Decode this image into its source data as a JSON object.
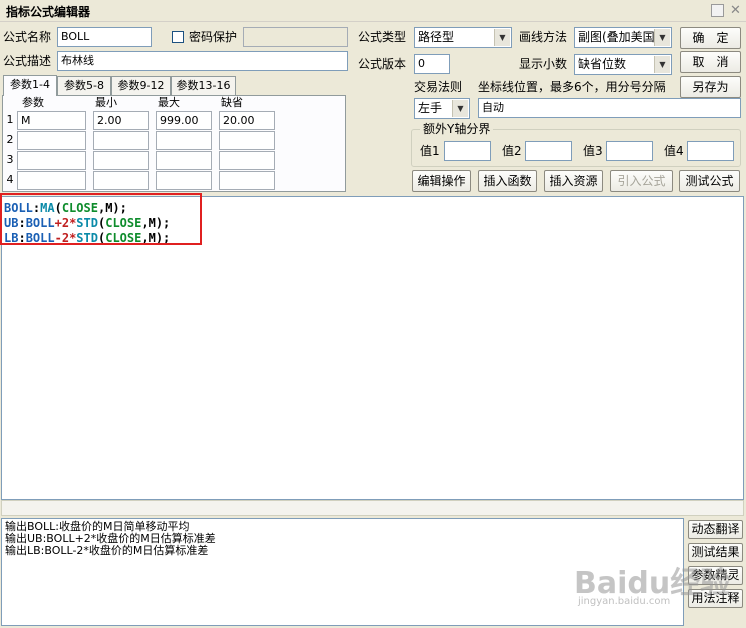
{
  "window": {
    "title": "指标公式编辑器"
  },
  "form": {
    "name_label": "公式名称",
    "name_value": "BOLL",
    "password_label": "密码保护",
    "desc_label": "公式描述",
    "desc_value": "布林线",
    "type_label": "公式类型",
    "type_value": "路径型",
    "draw_label": "画线方法",
    "draw_value": "副图(叠加美国",
    "version_label": "公式版本",
    "version_value": "0",
    "decimals_label": "显示小数",
    "decimals_value": "缺省位数",
    "trade_rule_label": "交易法则",
    "trade_rule_value": "左手",
    "coord_label": "坐标线位置，最多6个，用分号分隔",
    "coord_value": "自动",
    "yaxis_group_label": "额外Y轴分界",
    "yaxis_values": [
      "值1",
      "值2",
      "值3",
      "值4"
    ]
  },
  "buttons": {
    "ok": "确　定",
    "cancel": "取　消",
    "save_as": "另存为",
    "edit_ops": "编辑操作",
    "insert_func": "插入函数",
    "insert_res": "插入资源",
    "import_formula": "引入公式",
    "test_formula": "测试公式",
    "dynamic_translate": "动态翻译",
    "test_result": "测试结果",
    "param_tune": "参数精灵",
    "usage_notes": "用法注释"
  },
  "tabs": [
    "参数1-4",
    "参数5-8",
    "参数9-12",
    "参数13-16"
  ],
  "params": {
    "headers": [
      "参数",
      "最小",
      "最大",
      "缺省"
    ],
    "rows": [
      {
        "num": "1",
        "name": "M",
        "min": "2.00",
        "max": "999.00",
        "default": "20.00"
      },
      {
        "num": "2",
        "name": "",
        "min": "",
        "max": "",
        "default": ""
      },
      {
        "num": "3",
        "name": "",
        "min": "",
        "max": "",
        "default": ""
      },
      {
        "num": "4",
        "name": "",
        "min": "",
        "max": "",
        "default": ""
      }
    ]
  },
  "code": {
    "line1": {
      "name": "BOLL",
      "sep": ":",
      "fn": "MA",
      "open": "(",
      "arg1": "CLOSE",
      "comma": ",",
      "arg2": "M",
      "close": ");"
    },
    "line2": {
      "name": "UB",
      "sep": ":",
      "ref": "BOLL",
      "op": "+",
      "num": "2",
      "mul": "*",
      "fn": "STD",
      "open": "(",
      "arg1": "CLOSE",
      "comma": ",",
      "arg2": "M",
      "close": ");"
    },
    "line3": {
      "name": "LB",
      "sep": ":",
      "ref": "BOLL",
      "op": "-",
      "num": "2",
      "mul": "*",
      "fn": "STD",
      "open": "(",
      "arg1": "CLOSE",
      "comma": ",",
      "arg2": "M",
      "close": ");"
    }
  },
  "output": [
    "输出BOLL:收盘价的M日简单移动平均",
    "输出UB:BOLL+2*收盘价的M日估算标准差",
    "输出LB:BOLL-2*收盘价的M日估算标准差"
  ],
  "watermark": {
    "brand": "Baidu经验",
    "url": "jingyan.baidu.com"
  },
  "colors": {
    "highlight_box": "#e02020",
    "code_name": "#1a5fb4",
    "code_keyword": "#0e8c2c",
    "code_number": "#c02020"
  }
}
